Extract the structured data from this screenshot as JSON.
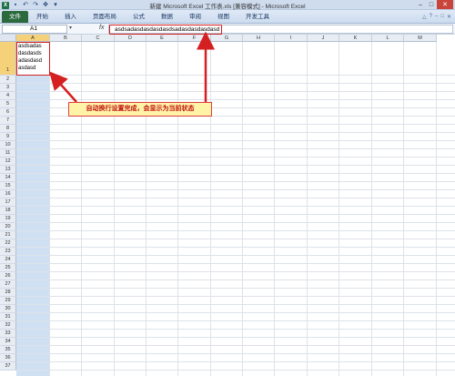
{
  "title_bar": {
    "title": "新建 Microsoft Excel 工作表.xls [兼容模式] - Microsoft Excel",
    "app_icon_label": "X",
    "qat_icons": [
      "save-icon",
      "undo-icon",
      "redo-icon",
      "format-painter-icon"
    ],
    "window_controls": {
      "minimize": "–",
      "maximize": "□",
      "close": "✕"
    }
  },
  "ribbon": {
    "tabs": [
      "文件",
      "开始",
      "插入",
      "页面布局",
      "公式",
      "数据",
      "审阅",
      "视图",
      "开发工具"
    ],
    "right_icons": [
      "△",
      "?",
      "–",
      "□",
      "✕"
    ]
  },
  "formula_bar": {
    "name_box": "A1",
    "fx_label": "fx",
    "content": "asdsadasdasdasdasdsadasdasdasdasd"
  },
  "grid": {
    "columns": [
      "A",
      "B",
      "C",
      "D",
      "E",
      "F",
      "G",
      "H",
      "I",
      "J",
      "K",
      "L",
      "M"
    ],
    "selected_column": "A",
    "rows": [
      "1",
      "2",
      "3",
      "4",
      "5",
      "6",
      "7",
      "8",
      "9",
      "10",
      "11",
      "12",
      "13",
      "14",
      "15",
      "16",
      "17",
      "18",
      "19",
      "20",
      "21",
      "22",
      "23",
      "24",
      "25",
      "26",
      "27",
      "28",
      "29",
      "30",
      "31",
      "32",
      "33",
      "34",
      "35",
      "36",
      "37"
    ],
    "selected_row": "1",
    "cell_a1_lines": [
      "asdsadas",
      "dasdasds",
      "adasdasd",
      "asdasd"
    ]
  },
  "annotation": {
    "text": "自动换行设置完成，会显示为当前状态",
    "border_color": "#e04040",
    "fill_color": "#fff3a8"
  },
  "colors": {
    "file_tab": "#2a6a3d",
    "selection_header": "#f5d27a",
    "column_selection": "#cfe0f3",
    "highlight": "#d42020"
  }
}
